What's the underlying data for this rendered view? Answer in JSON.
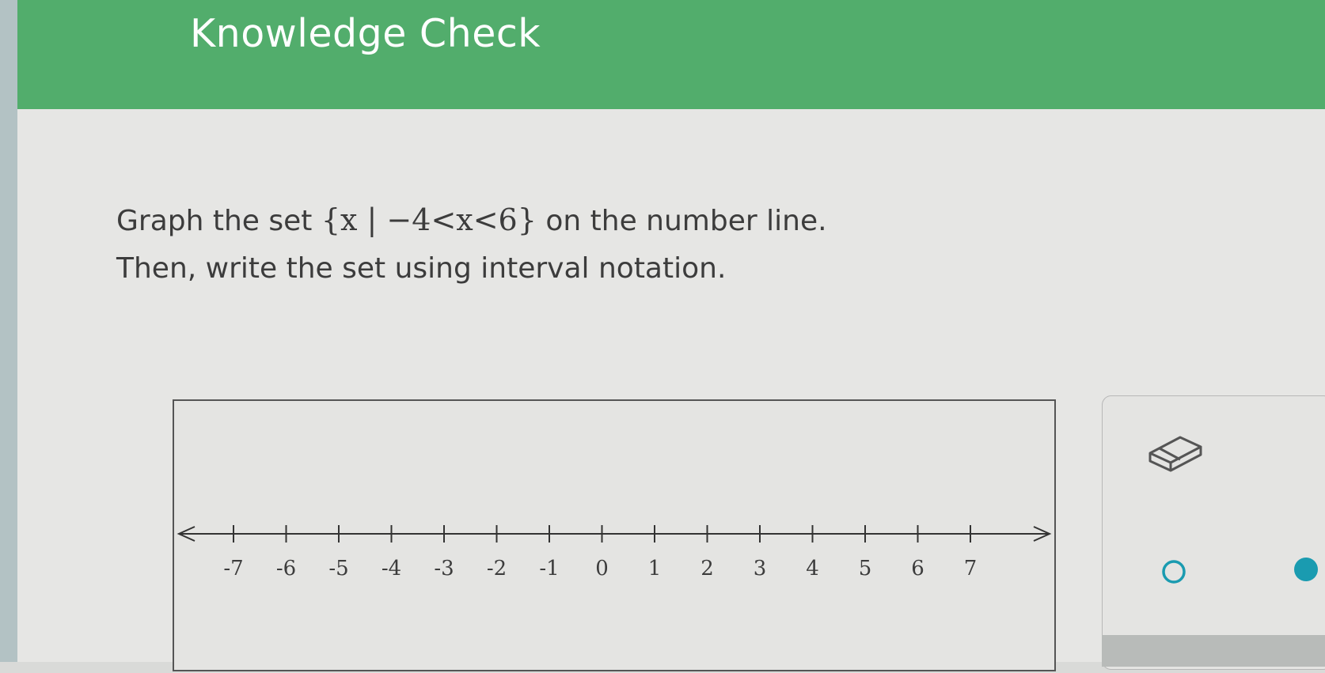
{
  "header": {
    "title": "Knowledge Check",
    "color": "#52ad6c"
  },
  "question": {
    "line1_prefix": "Graph the set ",
    "set_notation": "{x | −4<x<6}",
    "line1_suffix": " on the number line.",
    "line2": "Then, write the set using interval notation."
  },
  "number_line": {
    "tick_labels": [
      "-7",
      "-6",
      "-5",
      "-4",
      "-3",
      "-2",
      "-1",
      "0",
      "1",
      "2",
      "3",
      "4",
      "5",
      "6",
      "7"
    ],
    "min": -7,
    "max": 7
  },
  "tools": {
    "eraser_icon": "eraser-icon",
    "open_circle_icon": "open-circle-icon",
    "closed_circle_icon": "closed-circle-icon",
    "accent_color": "#1a9bb0"
  }
}
